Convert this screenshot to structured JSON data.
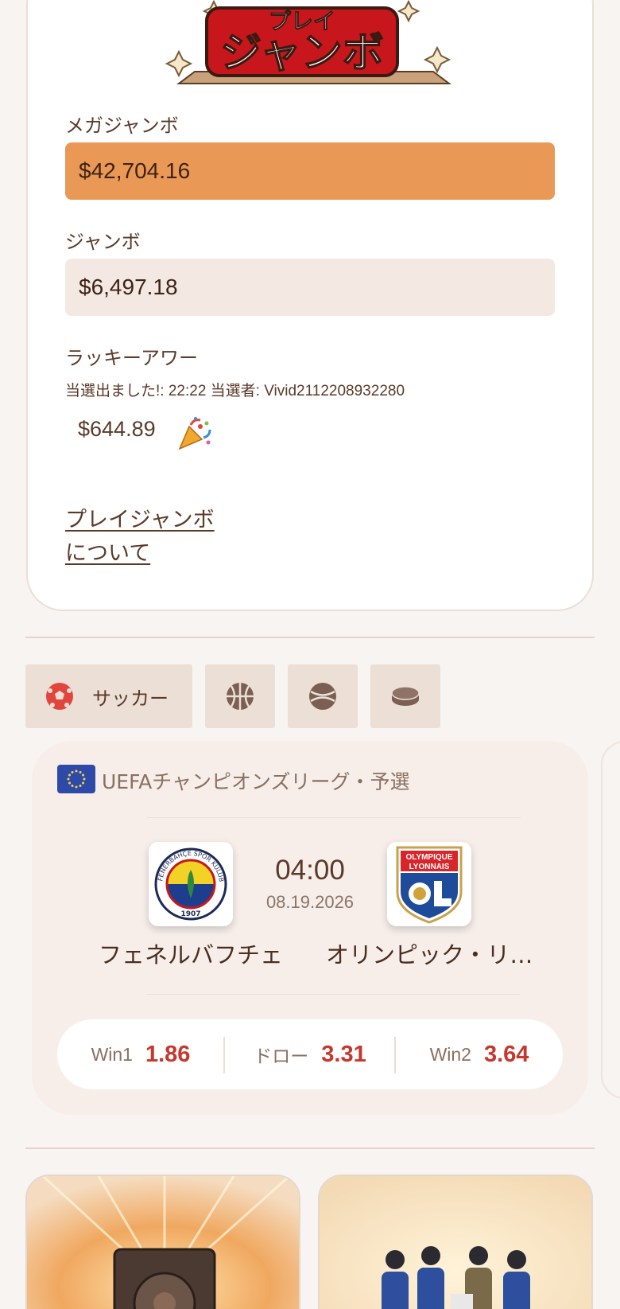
{
  "jackpot": {
    "logo_text_top": "プレイ",
    "logo_text_main": "ジャンボ",
    "mega_label": "メガジャンボ",
    "mega_value": "$42,704.16",
    "jumbo_label": "ジャンボ",
    "jumbo_value": "$6,497.18",
    "lucky_label": "ラッキーアワー",
    "lucky_info": "当選出ました!: 22:22 当選者: Vivid2112208932280",
    "lucky_amount": "$644.89",
    "about_link": "プレイジャンボについて"
  },
  "sports_tabs": [
    {
      "label": "サッカー",
      "icon": "soccer-ball-icon",
      "active": true
    },
    {
      "label": "",
      "icon": "basketball-icon",
      "active": false
    },
    {
      "label": "",
      "icon": "tennis-ball-icon",
      "active": false
    },
    {
      "label": "",
      "icon": "hockey-puck-icon",
      "active": false
    }
  ],
  "match": {
    "league": "UEFAチャンピオンズリーグ・予選",
    "time": "04:00",
    "date": "08.19.2026",
    "home": {
      "name": "フェネルバフチェ",
      "logo_text_ring": "FENERBAHÇE SPOR KULÜBÜ",
      "logo_year": "1907"
    },
    "away": {
      "name": "オリンピック・リ…",
      "logo_text_line1": "OLYMPIQUE",
      "logo_text_line2": "LYONNAIS"
    },
    "odds": [
      {
        "label": "Win1",
        "value": "1.86"
      },
      {
        "label": "ドロー",
        "value": "3.31"
      },
      {
        "label": "Win2",
        "value": "3.64"
      }
    ]
  },
  "colors": {
    "accent_orange": "#e99856",
    "odds_red": "#c6372e",
    "text_brown": "#5b3a29"
  }
}
